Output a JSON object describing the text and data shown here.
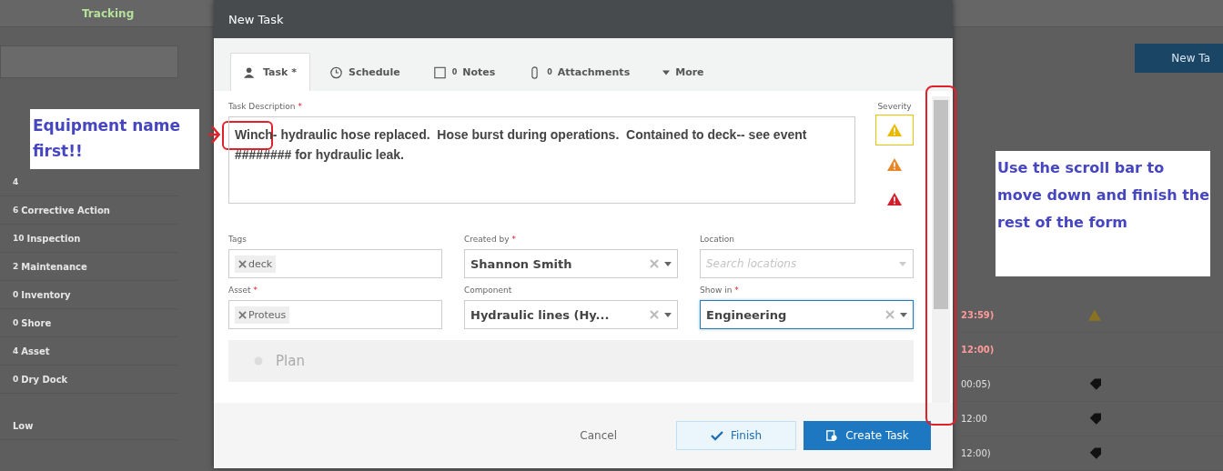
{
  "background": {
    "nav_tabs": [
      {
        "label": "Tracking",
        "selected": true
      }
    ],
    "sidebar_items": [
      {
        "count": "4"
      },
      {
        "count": "6",
        "label": "Corrective Action"
      },
      {
        "count": "10",
        "label": "Inspection"
      },
      {
        "count": "2",
        "label": "Maintenance"
      },
      {
        "count": "0",
        "label": "Inventory"
      },
      {
        "count": "0",
        "label": "Shore"
      },
      {
        "count": "4",
        "label": "Asset"
      },
      {
        "count": "0",
        "label": "Dry Dock"
      }
    ],
    "priority_item": {
      "label": "Low"
    },
    "new_task_button": "New Ta",
    "rows": [
      {
        "time": "23:59)",
        "overdue": true,
        "kind": "warning"
      },
      {
        "time": "12:00)",
        "overdue": true,
        "kind": "plain"
      },
      {
        "time": "00:05)",
        "overdue": false,
        "kind": "tagged"
      },
      {
        "time": "12:00",
        "overdue": false,
        "kind": "tagged"
      },
      {
        "time": "12:00)",
        "overdue": false,
        "kind": "tagged"
      }
    ]
  },
  "modal": {
    "title": "New Task",
    "tabs": [
      {
        "label": "Task *",
        "kind": "task",
        "selected": true
      },
      {
        "label": "Schedule",
        "kind": "schedule",
        "selected": false
      },
      {
        "label": "Notes",
        "count": "0",
        "kind": "notes",
        "selected": false
      },
      {
        "label": "Attachments",
        "count": "0",
        "kind": "attachments",
        "selected": false
      },
      {
        "label": "More",
        "kind": "menu",
        "selected": false
      }
    ],
    "description": {
      "label": "Task Description",
      "required_mark": "*",
      "value": "Winch- hydraulic hose replaced.  Hose burst during operations.  Contained to deck-- see event ######## for hydraulic leak."
    },
    "severity": {
      "label": "Severity",
      "options": [
        {
          "color": "#e8b900",
          "selected": true
        },
        {
          "color": "#e8862a",
          "selected": false
        },
        {
          "color": "#d0202e",
          "selected": false
        }
      ]
    },
    "fields": [
      {
        "label": "Tags",
        "kind": "tags",
        "value": "deck",
        "focused": false
      },
      {
        "label": "Created by",
        "required_mark": "*",
        "kind": "select",
        "value": "Shannon Smith",
        "focused": false
      },
      {
        "label": "Location",
        "kind": "search",
        "placeholder": "Search locations",
        "focused": false
      },
      {
        "label": "Asset",
        "required_mark": "*",
        "kind": "tags",
        "value": "Proteus",
        "focused": false
      },
      {
        "label": "Component",
        "kind": "select",
        "value": "Hydraulic lines (Hy...",
        "focused": false
      },
      {
        "label": "Show in",
        "required_mark": "*",
        "kind": "select",
        "value": "Engineering",
        "focused": true
      }
    ],
    "section": {
      "label": "Plan"
    },
    "buttons": [
      {
        "label": "Cancel",
        "kind": "link"
      },
      {
        "label": "Finish",
        "kind": "secondary"
      },
      {
        "label": "Create Task",
        "kind": "primary"
      }
    ]
  },
  "annotations": [
    {
      "kind": "left",
      "text": "Equipment name first!!"
    },
    {
      "kind": "right",
      "text": "Use the scroll bar to move down and finish the rest of the form"
    }
  ]
}
